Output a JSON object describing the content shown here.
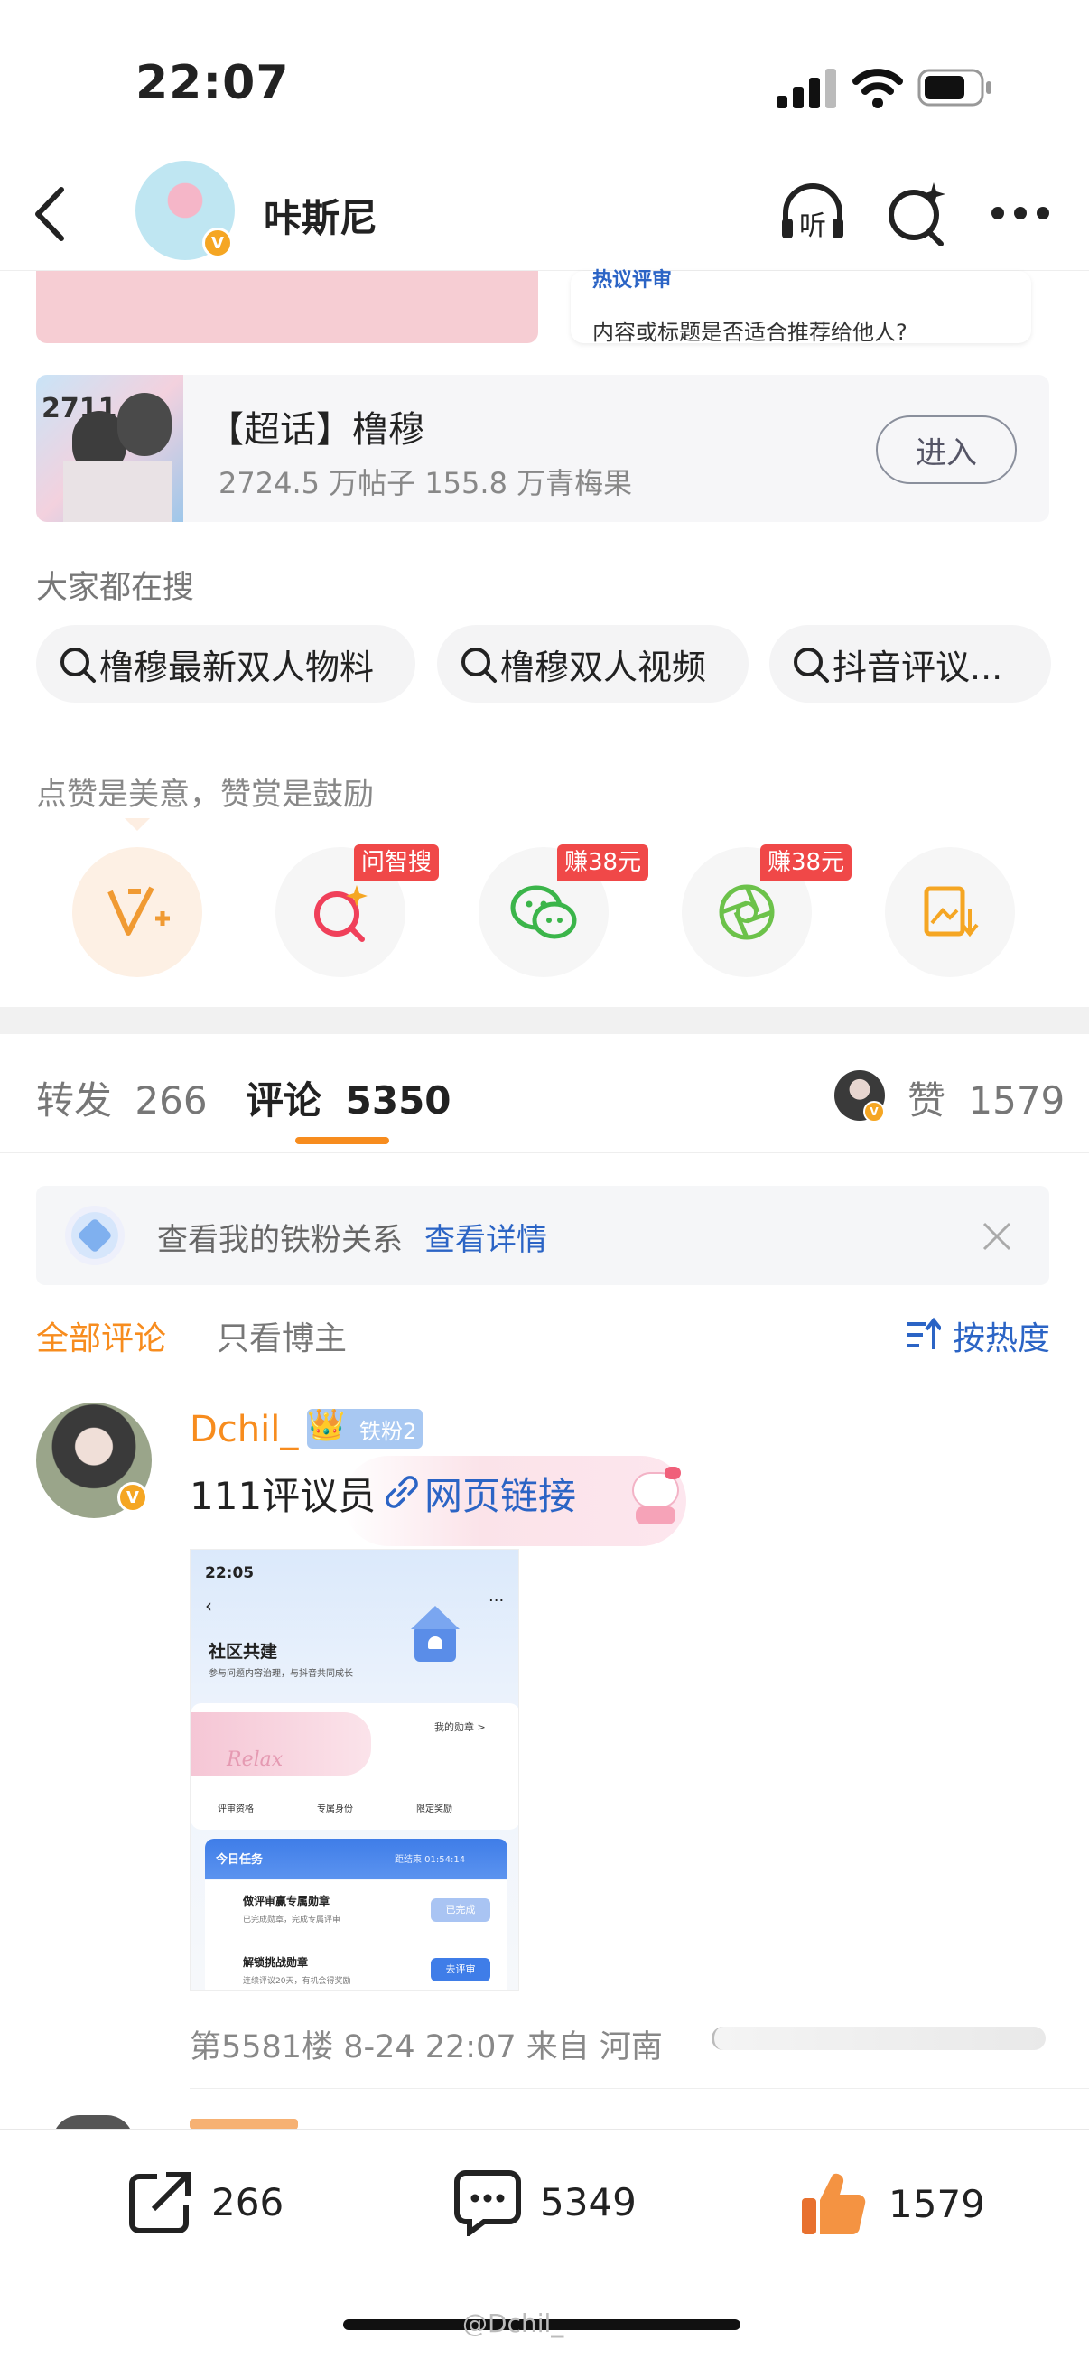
{
  "status_bar": {
    "time": "22:07"
  },
  "header": {
    "title": "咔斯尼"
  },
  "top_partial": {
    "hint_title": "热议评审",
    "hint_text": "内容或标题是否适合推荐给他人?"
  },
  "supertopic": {
    "name": "【超话】橹穆",
    "stats": "2724.5 万帖子 155.8 万青梅果",
    "enter_label": "进入",
    "cover_text": "2711"
  },
  "search_section": {
    "title": "大家都在搜",
    "suggestions": [
      "橹穆最新双人物料",
      "橹穆双人视频",
      "抖音评议..."
    ]
  },
  "share_section": {
    "slogan": "点赞是美意，赞赏是鼓励",
    "tags": [
      "问智搜",
      "赚38元",
      "赚38元"
    ]
  },
  "tabs": {
    "repost_label": "转发",
    "repost_count": "266",
    "comment_label": "评论",
    "comment_count": "5350",
    "like_label": "赞",
    "like_count": "1579"
  },
  "notice": {
    "text": "查看我的铁粉关系",
    "link": "查看详情"
  },
  "filters": {
    "all": "全部评论",
    "author_only": "只看博主",
    "sort": "按热度"
  },
  "comment": {
    "user": "Dchil_",
    "fan_badge": "铁粉2",
    "text": "111评议员",
    "link_text": "网页链接",
    "meta": "第5581楼 8-24 22:07 来自 河南",
    "screenshot": {
      "time": "22:05",
      "title": "社区共建",
      "subtitle": "参与问题内容治理，与抖音共同成长",
      "my_badge": "我的勋章 >",
      "relax": "Relax",
      "perks": [
        "评审资格",
        "专属身份",
        "限定奖励"
      ],
      "task_title": "今日任务",
      "task_deadline": "距结束 01:54:14",
      "task1": "做评审赢专属勋章",
      "task1_sub": "已完成勋章，完成专属评审",
      "task1_btn": "已完成",
      "task2": "解锁挑战勋章",
      "task2_sub": "连续评议20天，有机会得奖励",
      "task2_btn": "去评审"
    }
  },
  "bottom_bar": {
    "repost": "266",
    "comment": "5349",
    "like": "1579"
  },
  "watermark": "@Dchil_",
  "colors": {
    "orange": "#f78c1e",
    "blue_link": "#2b64c5",
    "red_tag": "#f04848"
  }
}
